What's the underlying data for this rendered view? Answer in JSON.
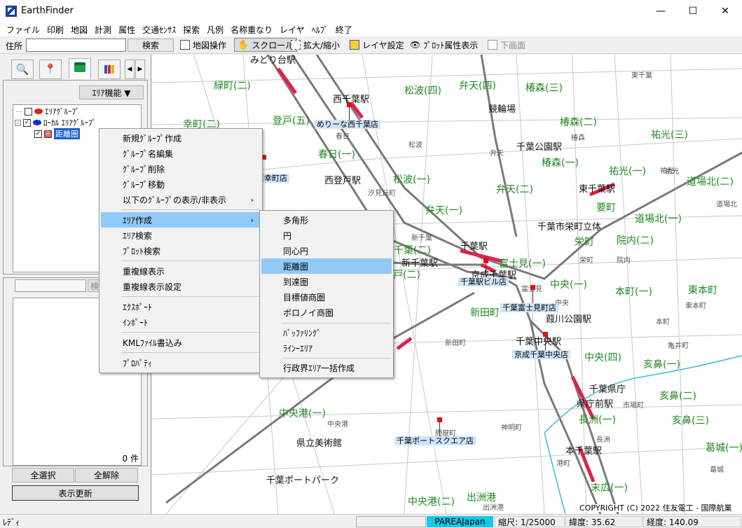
{
  "window": {
    "title": "EarthFinder",
    "min": "—",
    "max": "☐",
    "close": "✕"
  },
  "menu": [
    "ファイル",
    "印刷",
    "地図",
    "計測",
    "属性",
    "交通ｾﾝｻｽ",
    "探索",
    "凡例",
    "名称重なり",
    "レイヤ",
    "ﾍﾙﾌﾟ",
    "終了"
  ],
  "toolbar": {
    "address_label": "住所",
    "address_value": "",
    "search_button": "検索",
    "map_operation": "地図操作",
    "scroll": "スクロール",
    "zoom": "拡大/縮小",
    "layer_settings": "レイヤ設定",
    "plot_attr": "ﾌﾟﾛｯﾄ属性表示",
    "lower_screen": "下画面"
  },
  "left": {
    "area_func_button": "ｴﾘｱ機能 ▼",
    "tree": [
      {
        "label": "ｴﾘｱｸﾞﾙｰﾌﾟ",
        "checked": false,
        "color": "#e02020"
      },
      {
        "label": "ﾛｰｶﾙ ｴﾘｱｸﾞﾙｰﾌﾟ",
        "checked": true,
        "color": "#1030d0"
      },
      {
        "label": "距離圏",
        "checked": true
      }
    ],
    "search_button": "検",
    "count": "0 件",
    "select_all": "全選択",
    "clear_all": "全解除",
    "refresh": "表示更新"
  },
  "context_menu": {
    "items": [
      "新規ｸﾞﾙｰﾌﾟ作成",
      "ｸﾞﾙｰﾌﾟ名編集",
      "ｸﾞﾙｰﾌﾟ削除",
      "ｸﾞﾙｰﾌﾟ移動",
      "以下のｸﾞﾙｰﾌﾟの表示/非表示",
      "ｴﾘｱ作成",
      "ｴﾘｱ検索",
      "ﾌﾟﾛｯﾄ検索",
      "重複線表示",
      "重複線表示設定",
      "ｴｸｽﾎﾟｰﾄ",
      "ｲﾝﾎﾟｰﾄ",
      "KMLﾌｧｲﾙ書込み",
      "ﾌﾟﾛﾊﾟﾃｨ"
    ],
    "submenu_arrow": "›"
  },
  "submenu": {
    "items": [
      "多角形",
      "円",
      "同心円",
      "距離圏",
      "到達圏",
      "目標値商圏",
      "ボロノイ商圏",
      "ﾊﾞｯﾌｧﾘﾝｸﾞ",
      "ﾗｲﾝｰｴﾘｱ",
      "行政界ｴﾘｱ一括作成"
    ],
    "highlighted": "距離圏"
  },
  "map": {
    "green_labels": [
      "緑町(二)",
      "幸町(二)",
      "登戸(五)",
      "松波(四)",
      "弁天(四)",
      "椿森(三)",
      "椿森(二)",
      "祐光(三)",
      "春日(一)",
      "椿森(一)",
      "松波(一)",
      "弁天(二)",
      "祐光(一)",
      "道場北(二)",
      "弁天(一)",
      "要町",
      "道場北(一)",
      "栄町",
      "院内(二)",
      "千葉(二)",
      "戸(二)",
      "富士見(一)",
      "中央(一)",
      "本町(一)",
      "東本町",
      "新田町",
      "中央(四)",
      "亥鼻(一)",
      "亥鼻(二)",
      "長洲(一)",
      "亥鼻(三)",
      "中央港(一)",
      "葛城(一)",
      "中央港(二)",
      "出洲港",
      "末広(一)"
    ],
    "black_labels": [
      "みどり台駅",
      "西千葉駅",
      "競輪場",
      "千葉公園駅",
      "西登戸駅",
      "東千葉駅",
      "千葉市栄町立体",
      "千葉駅",
      "新千葉駅",
      "京成千葉駅",
      "葭川公園駅",
      "千葉中央駅",
      "千葉県庁",
      "県庁前駅",
      "県立美術館",
      "本千葉駅",
      "千葉ポートパーク"
    ],
    "gray_labels": [
      "東千葉",
      "春日",
      "松波",
      "弁天",
      "椿森",
      "汐見丘町",
      "祐光",
      "道場北",
      "新千葉",
      "栄町",
      "院内",
      "富士見",
      "中央",
      "東本町",
      "本町",
      "新田町",
      "亀井町",
      "市場町",
      "中央港",
      "神明町",
      "問屋町",
      "港町",
      "長洲",
      "葛城",
      "出洲港",
      "祐光"
    ],
    "shops": [
      "めりーな西千葉店",
      "幸町店",
      "千葉駅ビル店",
      "千葉富士見町店",
      "京成千葉中央店",
      "千葉ポートスクエア店"
    ],
    "copyright": "COPYRIGHT (C) 2022 住友電工 - 国際航業"
  },
  "status": {
    "ready": "ﾚﾃﾞｨ",
    "layer": "PAREAJapan",
    "scale": "縮尺: 1/25000",
    "lat": "緯度: 35.62",
    "lon": "経度: 140.09"
  },
  "colors": {
    "highlight": "#91c9f7",
    "shop_bg": "#cfe6fb",
    "map_green": "#1f8a1f",
    "rail_red": "#e0204a",
    "river": "#44b8d8"
  }
}
